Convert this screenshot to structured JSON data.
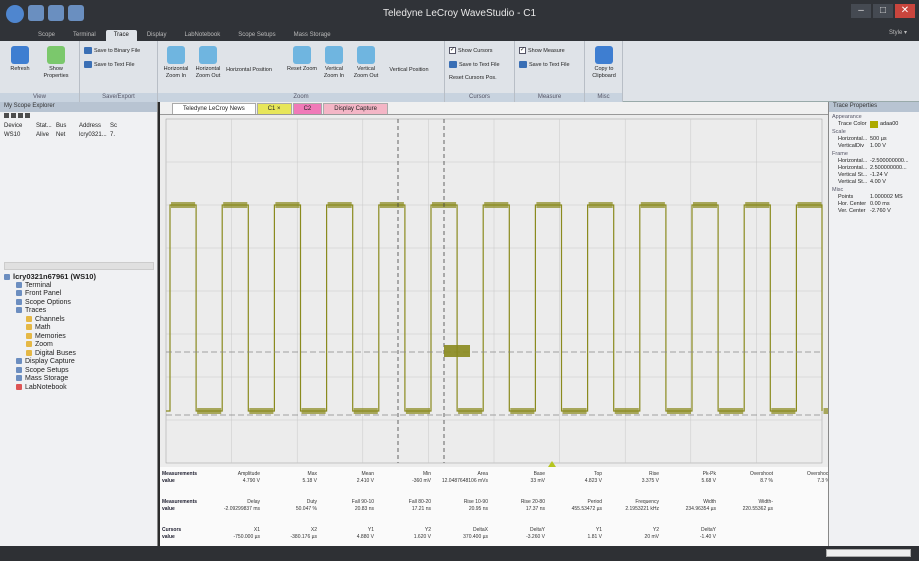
{
  "window": {
    "title": "Teledyne LeCroy WaveStudio - C1",
    "controls": [
      "–",
      "□",
      "✕"
    ]
  },
  "menu": {
    "items": [
      "Scope",
      "Terminal",
      "Trace",
      "Display",
      "LabNotebook",
      "Scope Setups",
      "Mass Storage"
    ],
    "active": "Trace",
    "style_label": "Style ▾"
  },
  "ribbon": {
    "view": {
      "label": "View",
      "refresh": "Refresh",
      "show_properties": "Show Properties"
    },
    "save_export": {
      "label": "Save/Export",
      "save_binary": "Save to Binary File",
      "save_text": "Save to Text File"
    },
    "zoom": {
      "label": "Zoom",
      "h_zoom_in": "Horizontal Zoom In",
      "h_zoom_out": "Horizontal Zoom Out",
      "h_position": "Horizontal Position",
      "reset_zoom": "Reset Zoom",
      "v_zoom_in": "Vertical Zoom In",
      "v_zoom_out": "Vertical Zoom Out",
      "v_position": "Vertical Position"
    },
    "cursors": {
      "label": "Cursors",
      "show_cursors": "Show Cursors",
      "save_text": "Save to Text File",
      "reset_pos": "Reset Cursors Pos."
    },
    "measure": {
      "label": "Measure",
      "show_measure": "Show Measure",
      "save_text": "Save to Text File"
    },
    "misc": {
      "label": "Misc",
      "copy_clipboard": "Copy to Clipboard"
    }
  },
  "explorer": {
    "title": "My Scope Explorer",
    "columns": [
      "Device",
      "Stat...",
      "Bus",
      "Address",
      "Sc"
    ],
    "row": [
      "WS10",
      "Alive",
      "Net",
      "lcry0321...",
      "7."
    ],
    "tree_root": "lcry0321n67961 (WS10)",
    "tree": [
      "Terminal",
      "Front Panel",
      "Scope Options",
      "Traces",
      "Channels",
      "Math",
      "Memories",
      "Zoom",
      "Digital Buses",
      "Display Capture",
      "Scope Setups",
      "Mass Storage",
      "LabNotebook"
    ]
  },
  "tabs": [
    "Teledyne LeCroy News",
    "C1",
    "C2",
    "Display Capture"
  ],
  "tab_close": "×",
  "colors": {
    "trace": "#8a8a1e",
    "tab_c1": "#e7e65a",
    "tab_c2": "#f07ab8",
    "tab_capture": "#f4b6c6"
  },
  "measurements": {
    "r1_label": [
      "Measurements",
      "value"
    ],
    "r1": [
      [
        "Amplitude",
        "4.790 V"
      ],
      [
        "Max",
        "5.18 V"
      ],
      [
        "Mean",
        "2.410 V"
      ],
      [
        "Min",
        "-360 mV"
      ],
      [
        "Area",
        "12.0487648106 mVs"
      ],
      [
        "Base",
        "33 mV"
      ],
      [
        "Top",
        "4.823 V"
      ],
      [
        "Rise",
        "3.375 V"
      ],
      [
        "Pk-Pk",
        "5.68 V"
      ],
      [
        "Overshoot",
        "8.7 %"
      ],
      [
        "Overshoot",
        "7.3 %"
      ]
    ],
    "r2_label": [
      "Measurements",
      "value"
    ],
    "r2": [
      [
        "Delay",
        "-2.09299837 ms"
      ],
      [
        "Duty",
        "50.047 %"
      ],
      [
        "Fall 90-10",
        "20.83 ns"
      ],
      [
        "Fall 80-20",
        "17.21 ns"
      ],
      [
        "Rise 10-90",
        "20.95 ns"
      ],
      [
        "Rise 20-80",
        "17.37 ns"
      ],
      [
        "Period",
        "455.53472 µs"
      ],
      [
        "Frequency",
        "2.1953221 kHz"
      ],
      [
        "Width",
        "234.96354 µs"
      ],
      [
        "Width-",
        "220.55362 µs"
      ]
    ],
    "r3_label": [
      "Cursors",
      "value"
    ],
    "r3": [
      [
        "X1",
        "-750.000 µs"
      ],
      [
        "X2",
        "-380.176 µs"
      ],
      [
        "Y1",
        "4.880 V"
      ],
      [
        "Y2",
        "1.620 V"
      ],
      [
        "DeltaX",
        "370.400 µs"
      ],
      [
        "DeltaY",
        "-3.260 V"
      ],
      [
        "Y1",
        "1.81 V"
      ],
      [
        "Y2",
        "20 mV"
      ],
      [
        "DeltaY",
        "-1.40 V"
      ]
    ]
  },
  "trace_properties": {
    "title": "Trace Properties",
    "appearance": "Appearance",
    "trace_color_k": "Trace Color",
    "trace_color_v": "adaa00",
    "scale": "Scale",
    "hdiv_k": "Horizontal...",
    "hdiv_v": "500 µs",
    "vdiv_k": "VerticalDiv",
    "vdiv_v": "1.00 V",
    "frame": "Frame",
    "f1k": "Horizontal...",
    "f1v": "-2.500000000...",
    "f2k": "Horizontal...",
    "f2v": "2.500000000...",
    "f3k": "Vertical St...",
    "f3v": "-1.24 V",
    "f4k": "Vertical St...",
    "f4v": "4.00 V",
    "misc": "Misc",
    "points_k": "Points",
    "points_v": "1.000002 MS",
    "hc_k": "Hor. Center",
    "hc_v": "0.00 ms",
    "vc_k": "Ver. Center",
    "vc_v": "-2.760 V"
  }
}
